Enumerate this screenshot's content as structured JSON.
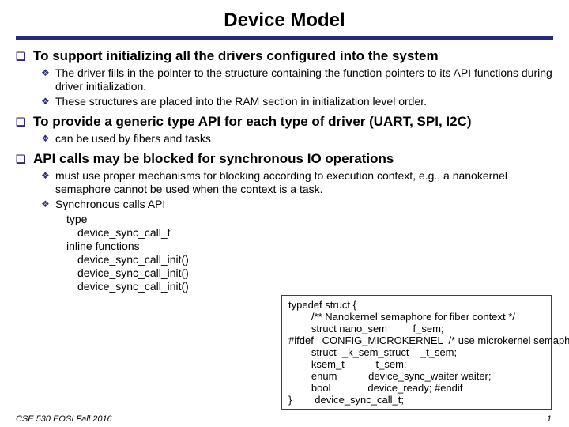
{
  "title": "Device Model",
  "items": [
    {
      "text": "To support initializing all the drivers configured into the system",
      "sub": [
        {
          "text": "The driver fills in the pointer to the structure containing the function pointers to its API functions during driver initialization."
        },
        {
          "text": "These structures are placed into the RAM section in initialization level order."
        }
      ]
    },
    {
      "text": "To provide a generic type API for each type of driver (UART, SPI, I2C)",
      "sub": [
        {
          "text": "can be used by fibers and tasks"
        }
      ]
    },
    {
      "text": "API calls may be blocked for synchronous IO operations",
      "sub": [
        {
          "text": "must use proper mechanisms for blocking according to execution context, e.g., a nanokernel semaphore cannot be used when the context is a task."
        },
        {
          "text": "Synchronous calls API",
          "sub": [
            "type",
            "  device_sync_call_t",
            "inline functions",
            "  device_sync_call_init()",
            "  device_sync_call_init()",
            "  device_sync_call_init()"
          ]
        }
      ]
    }
  ],
  "codebox": [
    "typedef struct {",
    "        /** Nanokernel semaphore for fiber context */",
    "        struct nano_sem         f_sem;",
    "#ifdef   CONFIG_MICROKERNEL  /* use microkernel semaphore */",
    "        struct  _k_sem_struct    _t_sem;",
    "        ksem_t           t_sem;",
    "        enum           device_sync_waiter waiter;",
    "        bool             device_ready; #endif",
    "}        device_sync_call_t;"
  ],
  "footer_left": "CSE 530 EOSI Fall 2016",
  "footer_right": "1"
}
